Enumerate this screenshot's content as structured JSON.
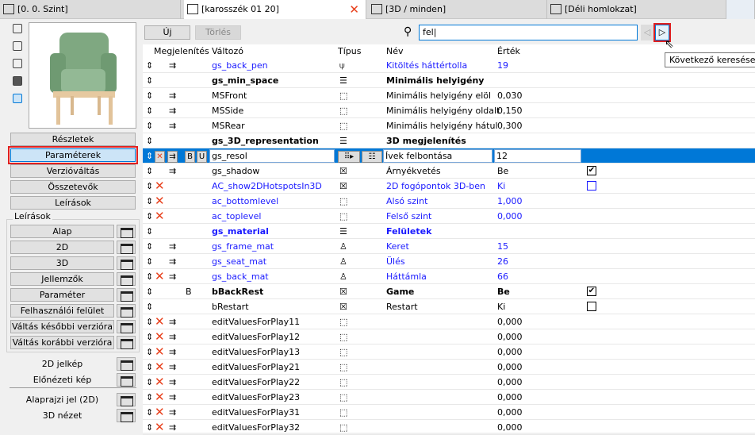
{
  "tabs": [
    {
      "label": "[0. 0. Szint]"
    },
    {
      "label": "[karosszék 01 20]",
      "active": true
    },
    {
      "label": "[3D / minden]"
    },
    {
      "label": "[Déli homlokzat]"
    }
  ],
  "left": {
    "nav": [
      "Részletek",
      "Paraméterek",
      "Verzióváltás",
      "Összetevők",
      "Leírások"
    ],
    "selected": "Paraméterek",
    "group_label": "Leírások",
    "scripts": [
      "Alap",
      "2D",
      "3D",
      "Jellemzők",
      "Paraméter",
      "Felhasználói felület",
      "Váltás későbbi verzióra",
      "Váltás korábbi verzióra"
    ],
    "extras": [
      "2D jelkép",
      "Előnézeti kép",
      "Alaprajzi jel (2D)",
      "3D nézet"
    ]
  },
  "toolbar": {
    "new_label": "Új",
    "delete_label": "Törlés",
    "search_value": "fel",
    "next_tooltip": "Következő keresése"
  },
  "columns": {
    "display": "Megjelenítés",
    "variable": "Változó",
    "type": "Típus",
    "name": "Név",
    "value": "Érték"
  },
  "rows": [
    {
      "var": "gs_back_pen",
      "type": "pen",
      "name": "Kitöltés háttértolla",
      "value": "19",
      "blue": true,
      "disp": true
    },
    {
      "var": "gs_min_space",
      "type": "title",
      "name": "Minimális helyigény",
      "value": "",
      "bold": true
    },
    {
      "var": "MSFront",
      "type": "length",
      "name": "Minimális helyigény elöl",
      "value": "0,030",
      "disp": true
    },
    {
      "var": "MSSide",
      "type": "length",
      "name": "Minimális helyigény oldalt",
      "value": "0,150",
      "disp": true
    },
    {
      "var": "MSRear",
      "type": "length",
      "name": "Minimális helyigény hátul",
      "value": "0,300",
      "disp": true
    },
    {
      "var": "gs_3D_representation",
      "type": "title",
      "name": "3D megjelenítés",
      "value": "",
      "bold": true
    },
    {
      "var": "gs_resol",
      "type": "integer",
      "name": "Ívek felbontása",
      "value": "12",
      "selected": true,
      "x": true,
      "disp": true
    },
    {
      "var": "gs_shadow",
      "type": "boolean",
      "name": "Árnyékvetés",
      "value": "Be",
      "disp": true,
      "check": true
    },
    {
      "var": "AC_show2DHotspotsIn3D",
      "type": "boolean",
      "name": "2D fogópontok 3D-ben",
      "value": "Ki",
      "blue": true,
      "x": true,
      "check": false
    },
    {
      "var": "ac_bottomlevel",
      "type": "length",
      "name": "Alsó szint",
      "value": "1,000",
      "blue": true,
      "x": true
    },
    {
      "var": "ac_toplevel",
      "type": "length",
      "name": "Felső szint",
      "value": "0,000",
      "blue": true,
      "x": true
    },
    {
      "var": "gs_material",
      "type": "title",
      "name": "Felületek",
      "value": "",
      "blue": true,
      "bold": true
    },
    {
      "var": "gs_frame_mat",
      "type": "material",
      "name": "Keret",
      "value": "15",
      "blue": true,
      "disp": true
    },
    {
      "var": "gs_seat_mat",
      "type": "material",
      "name": "Ülés",
      "value": "26",
      "blue": true,
      "disp": true
    },
    {
      "var": "gs_back_mat",
      "type": "material",
      "name": "Háttámla",
      "value": "66",
      "blue": true,
      "x": true,
      "disp": true
    },
    {
      "var": "bBackRest",
      "type": "boolean",
      "name": "Game",
      "value": "Be",
      "bold": true,
      "flag": "B",
      "check": true
    },
    {
      "var": "bRestart",
      "type": "boolean",
      "name": "Restart",
      "value": "Ki",
      "check": false
    },
    {
      "var": "editValuesForPlay11",
      "type": "length",
      "name": "",
      "value": "0,000",
      "x": true,
      "disp": true
    },
    {
      "var": "editValuesForPlay12",
      "type": "length",
      "name": "",
      "value": "0,000",
      "x": true,
      "disp": true
    },
    {
      "var": "editValuesForPlay13",
      "type": "length",
      "name": "",
      "value": "0,000",
      "x": true,
      "disp": true
    },
    {
      "var": "editValuesForPlay21",
      "type": "length",
      "name": "",
      "value": "0,000",
      "x": true,
      "disp": true
    },
    {
      "var": "editValuesForPlay22",
      "type": "length",
      "name": "",
      "value": "0,000",
      "x": true,
      "disp": true
    },
    {
      "var": "editValuesForPlay23",
      "type": "length",
      "name": "",
      "value": "0,000",
      "x": true,
      "disp": true
    },
    {
      "var": "editValuesForPlay31",
      "type": "length",
      "name": "",
      "value": "0,000",
      "x": true,
      "disp": true
    },
    {
      "var": "editValuesForPlay32",
      "type": "length",
      "name": "",
      "value": "0,000",
      "x": true,
      "disp": true
    }
  ],
  "selected_row_flags": {
    "bold": "B",
    "underline": "U"
  },
  "colors": {
    "accent": "#0078d7",
    "highlight": "#e02020",
    "param_blue": "#1a1aff",
    "delete_x": "#e8401c"
  }
}
